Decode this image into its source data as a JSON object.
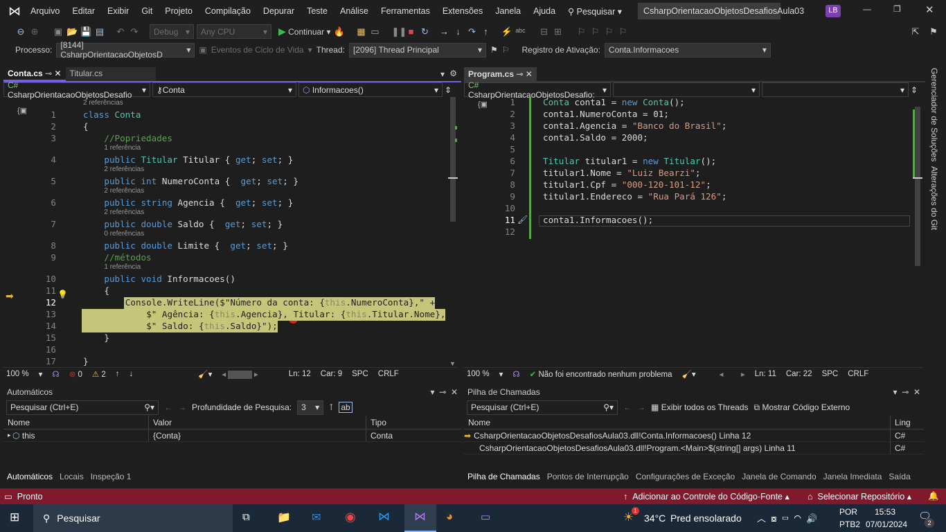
{
  "titlebar": {
    "menus": [
      "Arquivo",
      "Editar",
      "Exibir",
      "Git",
      "Projeto",
      "Compilação",
      "Depurar",
      "Teste",
      "Análise",
      "Ferramentas",
      "Extensões",
      "Janela",
      "Ajuda"
    ],
    "search": "Pesquisar",
    "solution": "CsharpOrientacaoObjetosDesafiosAula03",
    "user": "LB"
  },
  "toolbar": {
    "config": "Debug",
    "platform": "Any CPU",
    "continue": "Continuar"
  },
  "debugbar": {
    "process_label": "Processo:",
    "process": "[8144] CsharpOrientacaoObjetosD",
    "lifecycle": "Eventos de Ciclo de Vida",
    "thread_label": "Thread:",
    "thread": "[2096] Thread Principal",
    "stack_label": "Registro de Ativação:",
    "stack": "Conta.Informacoes"
  },
  "left_editor": {
    "tabs": [
      "Conta.cs",
      "Titular.cs"
    ],
    "nav_project": "CsharpOrientacaoObjetosDesafio",
    "nav_class": "Conta",
    "nav_member": "Informacoes()",
    "lines": [
      {
        "n": "1",
        "lens": "2 referências",
        "indent": 0,
        "t": [
          [
            "class ",
            "kw"
          ],
          [
            "Conta",
            "ty"
          ]
        ]
      },
      {
        "n": "2",
        "indent": 0,
        "t": [
          [
            "{",
            "id"
          ]
        ]
      },
      {
        "n": "3",
        "indent": 4,
        "t": [
          [
            "//Popriedades",
            "cm"
          ]
        ]
      },
      {
        "n": "4",
        "lens": "1 referência",
        "indent": 4,
        "t": [
          [
            "public ",
            "kw"
          ],
          [
            "Titular ",
            "ty"
          ],
          [
            "Titular { ",
            "id"
          ],
          [
            "get",
            "kw"
          ],
          [
            "; ",
            "id"
          ],
          [
            "set",
            "kw"
          ],
          [
            "; }",
            "id"
          ]
        ]
      },
      {
        "n": "5",
        "lens": "2 referências",
        "indent": 4,
        "t": [
          [
            "public ",
            "kw"
          ],
          [
            "int ",
            "kw"
          ],
          [
            "NumeroConta {  ",
            "id"
          ],
          [
            "get",
            "kw"
          ],
          [
            "; ",
            "id"
          ],
          [
            "set",
            "kw"
          ],
          [
            "; }",
            "id"
          ]
        ]
      },
      {
        "n": "6",
        "lens": "2 referências",
        "indent": 4,
        "t": [
          [
            "public ",
            "kw"
          ],
          [
            "string ",
            "kw"
          ],
          [
            "Agencia {  ",
            "id"
          ],
          [
            "get",
            "kw"
          ],
          [
            "; ",
            "id"
          ],
          [
            "set",
            "kw"
          ],
          [
            "; }",
            "id"
          ]
        ]
      },
      {
        "n": "7",
        "lens": "2 referências",
        "indent": 4,
        "t": [
          [
            "public ",
            "kw"
          ],
          [
            "double ",
            "kw"
          ],
          [
            "Saldo {  ",
            "id"
          ],
          [
            "get",
            "kw"
          ],
          [
            "; ",
            "id"
          ],
          [
            "set",
            "kw"
          ],
          [
            "; }",
            "id"
          ]
        ]
      },
      {
        "n": "8",
        "lens": "0 referências",
        "indent": 4,
        "t": [
          [
            "public ",
            "kw"
          ],
          [
            "double ",
            "kw"
          ],
          [
            "Limite {  ",
            "id"
          ],
          [
            "get",
            "kw"
          ],
          [
            "; ",
            "id"
          ],
          [
            "set",
            "kw"
          ],
          [
            "; }",
            "id"
          ]
        ]
      },
      {
        "n": "9",
        "indent": 4,
        "t": [
          [
            "//métodos",
            "cm"
          ]
        ]
      },
      {
        "n": "10",
        "lens": "1 referência",
        "indent": 4,
        "t": [
          [
            "public ",
            "kw"
          ],
          [
            "void ",
            "kw"
          ],
          [
            "Informacoes()",
            "id"
          ]
        ]
      },
      {
        "n": "11",
        "indent": 4,
        "t": [
          [
            "{",
            "id"
          ]
        ]
      },
      {
        "n": "12",
        "indent": 8,
        "hl": true,
        "t": [
          [
            "Console.WriteLine($\"Número da conta: {",
            "id"
          ],
          [
            "this",
            "th"
          ],
          [
            ".NumeroConta},\" +",
            "id"
          ]
        ]
      },
      {
        "n": "13",
        "indent": 12,
        "hl": true,
        "t": [
          [
            "$\" Agência: {",
            "id"
          ],
          [
            "this",
            "th"
          ],
          [
            ".Agencia}, Titular: {",
            "id"
          ],
          [
            "this",
            "th"
          ],
          [
            ".Titular.Nome},",
            "id"
          ]
        ]
      },
      {
        "n": "14",
        "indent": 12,
        "hl": true,
        "t": [
          [
            "$\" Saldo: {",
            "id"
          ],
          [
            "this",
            "th"
          ],
          [
            ".Saldo}\");",
            "id"
          ]
        ]
      },
      {
        "n": "15",
        "indent": 4,
        "t": [
          [
            "}",
            "id"
          ]
        ]
      },
      {
        "n": "16",
        "indent": 0,
        "t": []
      },
      {
        "n": "17",
        "indent": 0,
        "t": [
          [
            "}",
            "id"
          ]
        ]
      }
    ],
    "status": {
      "zoom": "100 %",
      "errors": "0",
      "warnings": "2",
      "ln": "Ln: 12",
      "car": "Car: 9",
      "spc": "SPC",
      "crlf": "CRLF"
    }
  },
  "right_editor": {
    "tab": "Program.cs",
    "nav_project": "CsharpOrientacaoObjetosDesafio:",
    "lines": [
      {
        "n": "1",
        "t": [
          [
            "Conta ",
            "ty"
          ],
          [
            "conta1 = ",
            "id"
          ],
          [
            "new ",
            "kw"
          ],
          [
            "Conta",
            "ty"
          ],
          [
            "();",
            "id"
          ]
        ]
      },
      {
        "n": "2",
        "t": [
          [
            "conta1.NumeroConta = 01;",
            "id"
          ]
        ]
      },
      {
        "n": "3",
        "t": [
          [
            "conta1.Agencia = ",
            "id"
          ],
          [
            "\"Banco do Brasil\"",
            "st"
          ],
          [
            ";",
            "id"
          ]
        ]
      },
      {
        "n": "4",
        "t": [
          [
            "conta1.Saldo = 2000;",
            "id"
          ]
        ]
      },
      {
        "n": "5",
        "t": []
      },
      {
        "n": "6",
        "t": [
          [
            "Titular ",
            "ty"
          ],
          [
            "titular1 = ",
            "id"
          ],
          [
            "new ",
            "kw"
          ],
          [
            "Titular",
            "ty"
          ],
          [
            "();",
            "id"
          ]
        ]
      },
      {
        "n": "7",
        "t": [
          [
            "titular1.Nome = ",
            "id"
          ],
          [
            "\"Luiz Bearzi\"",
            "st"
          ],
          [
            ";",
            "id"
          ]
        ]
      },
      {
        "n": "8",
        "t": [
          [
            "titular1.Cpf = ",
            "id"
          ],
          [
            "\"000-120-101-12\"",
            "st"
          ],
          [
            ";",
            "id"
          ]
        ]
      },
      {
        "n": "9",
        "t": [
          [
            "titular1.Endereco = ",
            "id"
          ],
          [
            "\"Rua Pará 126\"",
            "st"
          ],
          [
            ";",
            "id"
          ]
        ]
      },
      {
        "n": "10",
        "t": []
      },
      {
        "n": "11",
        "t": [
          [
            "conta1.Informacoes();",
            "id"
          ]
        ]
      },
      {
        "n": "12",
        "t": []
      }
    ],
    "status": {
      "zoom": "100 %",
      "issues": "Não foi encontrado nenhum problema",
      "ln": "Ln: 11",
      "car": "Car: 22",
      "spc": "SPC",
      "crlf": "CRLF"
    }
  },
  "side_tabs": [
    "Gerenciador de Soluções",
    "Alterações do Git"
  ],
  "autos": {
    "title": "Automáticos",
    "search": "Pesquisar (Ctrl+E)",
    "depth_label": "Profundidade de Pesquisa:",
    "depth": "3",
    "cols": [
      "Nome",
      "Valor",
      "Tipo"
    ],
    "rows": [
      {
        "name": "this",
        "value": "{Conta}",
        "type": "Conta"
      }
    ],
    "tabs": [
      "Automáticos",
      "Locais",
      "Inspeção 1"
    ]
  },
  "callstack": {
    "title": "Pilha de Chamadas",
    "search": "Pesquisar (Ctrl+E)",
    "show_threads": "Exibir todos os Threads",
    "show_external": "Mostrar Código Externo",
    "cols": [
      "Nome",
      "Ling"
    ],
    "rows": [
      {
        "name": "CsharpOrientacaoObjetosDesafiosAula03.dll!Conta.Informacoes() Linha 12",
        "lang": "C#"
      },
      {
        "name": "CsharpOrientacaoObjetosDesafiosAula03.dll!Program.<Main>$(string[] args) Linha 11",
        "lang": "C#"
      }
    ],
    "tabs": [
      "Pilha de Chamadas",
      "Pontos de Interrupção",
      "Configurações de Exceção",
      "Janela de Comando",
      "Janela Imediata",
      "Saída"
    ]
  },
  "statusbar": {
    "ready": "Pronto",
    "source_control": "Adicionar ao Controle do Código-Fonte",
    "repo": "Selecionar Repositório",
    "color": "#7e1a2b"
  },
  "taskbar": {
    "search": "Pesquisar",
    "weather_temp": "34°C",
    "weather": "Pred ensolarado",
    "weather_badge": "1",
    "lang1": "POR",
    "lang2": "PTB2",
    "time": "15:53",
    "date": "07/01/2024",
    "notif": "2"
  }
}
